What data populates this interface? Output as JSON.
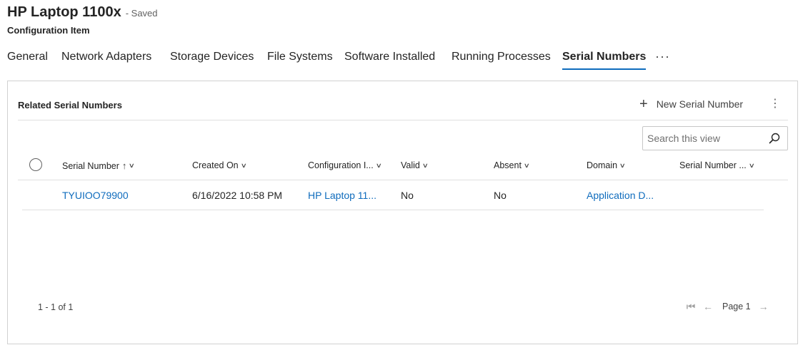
{
  "header": {
    "title": "HP Laptop 1100x",
    "save_status": "- Saved",
    "entity_type": "Configuration Item"
  },
  "tabs": [
    {
      "label": "General",
      "active": false
    },
    {
      "label": "Network Adapters",
      "active": false
    },
    {
      "label": "Storage Devices",
      "active": false
    },
    {
      "label": "File Systems",
      "active": false
    },
    {
      "label": "Software Installed",
      "active": false
    },
    {
      "label": "Running Processes",
      "active": false
    },
    {
      "label": "Serial Numbers",
      "active": true
    }
  ],
  "tabs_more": "···",
  "grid": {
    "title": "Related Serial Numbers",
    "new_button_label": "New Serial Number",
    "more_icon": "more-vertical-icon",
    "search_placeholder": "Search this view",
    "columns": [
      {
        "label": "Serial Number",
        "sorted": "ascending"
      },
      {
        "label": "Created On"
      },
      {
        "label": "Configuration I..."
      },
      {
        "label": "Valid"
      },
      {
        "label": "Absent"
      },
      {
        "label": "Domain"
      },
      {
        "label": "Serial Number ..."
      }
    ],
    "rows": [
      {
        "serial_number": "TYUIOO79900",
        "created_on": "6/16/2022 10:58 PM",
        "configuration_item": "HP Laptop 11...",
        "valid": "No",
        "absent": "No",
        "domain": "Application D...",
        "serial_number_type": ""
      }
    ],
    "record_count": "1 - 1 of 1",
    "page_label": "Page 1"
  },
  "colors": {
    "accent": "#0f6cbd",
    "text": "#242424",
    "border": "#d1d1d1"
  }
}
